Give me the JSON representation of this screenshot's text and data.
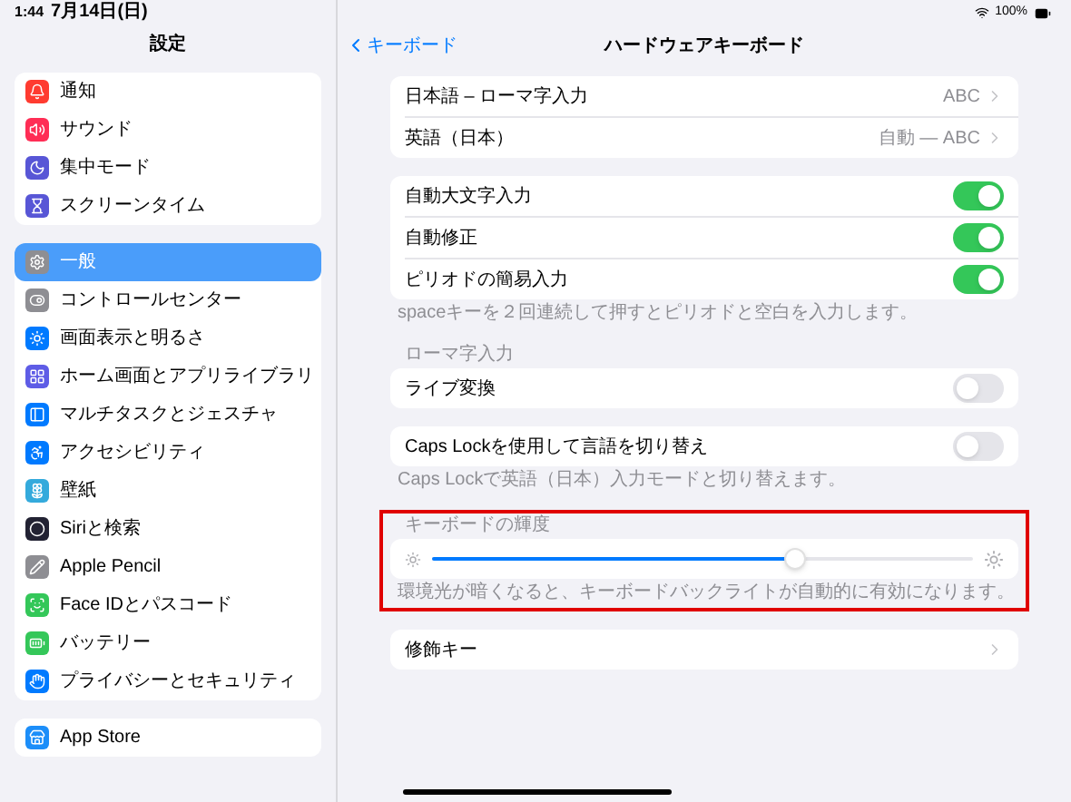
{
  "status_bar": {
    "time": "1:44",
    "date": "7月14日(日)",
    "battery": "100%"
  },
  "sidebar": {
    "title": "設定",
    "groups": [
      [
        {
          "label": "通知",
          "color": "#ff3b30",
          "selected": false
        },
        {
          "label": "サウンド",
          "color": "#ff2d55",
          "selected": false
        },
        {
          "label": "集中モード",
          "color": "#5856d6",
          "selected": false
        },
        {
          "label": "スクリーンタイム",
          "color": "#5856d6",
          "selected": false
        }
      ],
      [
        {
          "label": "一般",
          "color": "#8e8e93",
          "selected": true
        },
        {
          "label": "コントロールセンター",
          "color": "#8e8e93",
          "selected": false
        },
        {
          "label": "画面表示と明るさ",
          "color": "#007aff",
          "selected": false
        },
        {
          "label": "ホーム画面とアプリライブラリ",
          "color": "#5e5ce6",
          "selected": false
        },
        {
          "label": "マルチタスクとジェスチャ",
          "color": "#007aff",
          "selected": false
        },
        {
          "label": "アクセシビリティ",
          "color": "#007aff",
          "selected": false
        },
        {
          "label": "壁紙",
          "color": "#34aadc",
          "selected": false
        },
        {
          "label": "Siriと検索",
          "color": "#222233",
          "selected": false
        },
        {
          "label": "Apple Pencil",
          "color": "#8e8e93",
          "selected": false
        },
        {
          "label": "Face IDとパスコード",
          "color": "#34c759",
          "selected": false
        },
        {
          "label": "バッテリー",
          "color": "#34c759",
          "selected": false
        },
        {
          "label": "プライバシーとセキュリティ",
          "color": "#007aff",
          "selected": false
        }
      ],
      [
        {
          "label": "App Store",
          "color": "#1c8ef9",
          "selected": false
        }
      ]
    ]
  },
  "nav": {
    "back": "キーボード",
    "title": "ハードウェアキーボード"
  },
  "sections": [
    {
      "rows": [
        {
          "kind": "link",
          "label": "日本語 – ローマ字入力",
          "value": "ABC"
        },
        {
          "kind": "link",
          "label": "英語（日本）",
          "value": "自動 — ABC"
        }
      ]
    },
    {
      "rows": [
        {
          "kind": "toggle",
          "label": "自動大文字入力",
          "on": true
        },
        {
          "kind": "toggle",
          "label": "自動修正",
          "on": true
        },
        {
          "kind": "toggle",
          "label": "ピリオドの簡易入力",
          "on": true
        }
      ],
      "footer": "spaceキーを２回連続して押すとピリオドと空白を入力します。"
    },
    {
      "header": "ローマ字入力",
      "rows": [
        {
          "kind": "toggle",
          "label": "ライブ変換",
          "on": false
        }
      ]
    },
    {
      "rows": [
        {
          "kind": "toggle",
          "label": "Caps Lockを使用して言語を切り替え",
          "on": false
        }
      ],
      "footer": "Caps Lockで英語（日本）入力モードと切り替えます。"
    },
    {
      "header": "キーボードの輝度",
      "highlighted": true,
      "rows": [
        {
          "kind": "slider",
          "level": 0.67
        }
      ],
      "footer": "環境光が暗くなると、キーボードバックライトが自動的に有効になります。"
    },
    {
      "rows": [
        {
          "kind": "link",
          "label": "修飾キー"
        }
      ]
    }
  ]
}
